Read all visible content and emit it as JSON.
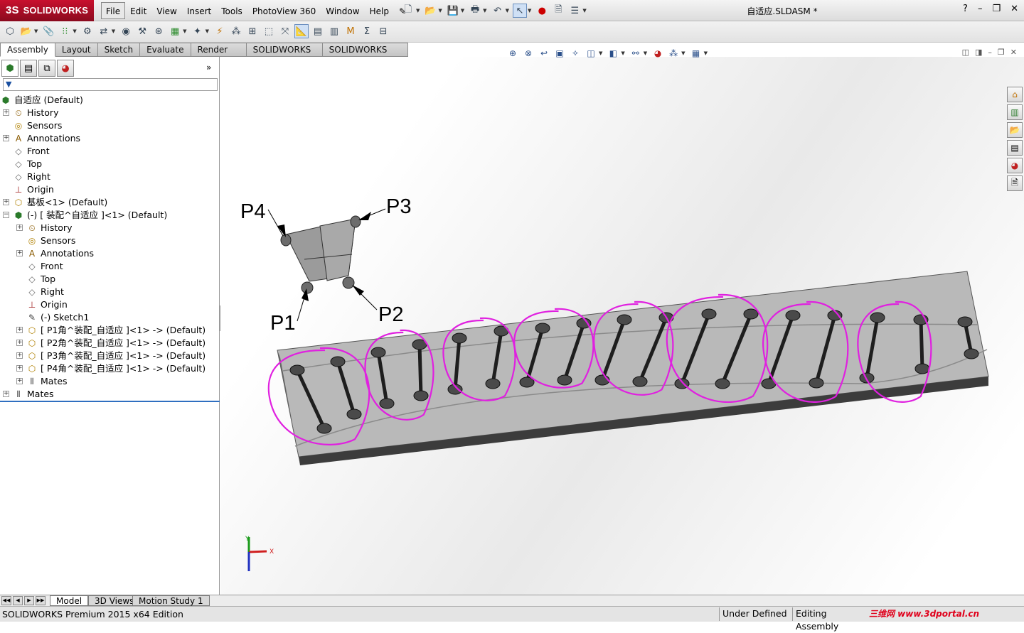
{
  "app": {
    "logo_prefix": "3S",
    "logo_text": "SOLIDWORKS",
    "doc_title": "自适应.SLDASM *"
  },
  "menu": [
    "File",
    "Edit",
    "View",
    "Insert",
    "Tools",
    "PhotoView 360",
    "Window",
    "Help"
  ],
  "window_controls": [
    "?",
    "–",
    "❐",
    "✕"
  ],
  "command_tabs": [
    "Assembly",
    "Layout",
    "Sketch",
    "Evaluate",
    "Render Tools",
    "SOLIDWORKS MBD",
    "SOLIDWORKS Add-Ins"
  ],
  "panel": {
    "expand_glyph": "»",
    "filter_glyph": "▼"
  },
  "tree": [
    {
      "label": "自适应  (Default)",
      "level": 0,
      "icon": "assembly-icon",
      "expander": ""
    },
    {
      "label": "History",
      "level": 0,
      "icon": "history-icon",
      "expander": "+"
    },
    {
      "label": "Sensors",
      "level": 0,
      "icon": "sensor-icon",
      "expander": ""
    },
    {
      "label": "Annotations",
      "level": 0,
      "icon": "annotation-icon",
      "expander": "+"
    },
    {
      "label": "Front",
      "level": 0,
      "icon": "plane-icon",
      "expander": ""
    },
    {
      "label": "Top",
      "level": 0,
      "icon": "plane-icon",
      "expander": ""
    },
    {
      "label": "Right",
      "level": 0,
      "icon": "plane-icon",
      "expander": ""
    },
    {
      "label": "Origin",
      "level": 0,
      "icon": "origin-icon",
      "expander": ""
    },
    {
      "label": "基板<1> (Default)",
      "level": 0,
      "icon": "part-icon",
      "expander": "+"
    },
    {
      "label": "(-) [ 装配^自适应 ]<1> (Default)",
      "level": 0,
      "icon": "subassembly-icon",
      "expander": "−"
    },
    {
      "label": "History",
      "level": 1,
      "icon": "history-icon",
      "expander": "+"
    },
    {
      "label": "Sensors",
      "level": 1,
      "icon": "sensor-icon",
      "expander": ""
    },
    {
      "label": "Annotations",
      "level": 1,
      "icon": "annotation-icon",
      "expander": "+"
    },
    {
      "label": "Front",
      "level": 1,
      "icon": "plane-icon",
      "expander": ""
    },
    {
      "label": "Top",
      "level": 1,
      "icon": "plane-icon",
      "expander": ""
    },
    {
      "label": "Right",
      "level": 1,
      "icon": "plane-icon",
      "expander": ""
    },
    {
      "label": "Origin",
      "level": 1,
      "icon": "origin-icon",
      "expander": ""
    },
    {
      "label": "(-) Sketch1",
      "level": 1,
      "icon": "sketch-icon",
      "expander": ""
    },
    {
      "label": "[ P1角^装配_自适应 ]<1> -> (Default)",
      "level": 1,
      "icon": "part-icon",
      "expander": "+"
    },
    {
      "label": "[ P2角^装配_自适应 ]<1> -> (Default)",
      "level": 1,
      "icon": "part-icon",
      "expander": "+"
    },
    {
      "label": "[ P3角^装配_自适应 ]<1> -> (Default)",
      "level": 1,
      "icon": "part-icon",
      "expander": "+"
    },
    {
      "label": "[ P4角^装配_自适应 ]<1> -> (Default)",
      "level": 1,
      "icon": "part-icon",
      "expander": "+"
    },
    {
      "label": "Mates",
      "level": 1,
      "icon": "mates-icon",
      "expander": "+"
    },
    {
      "label": "Mates",
      "level": 0,
      "icon": "mates-icon",
      "expander": "+"
    }
  ],
  "model_labels": {
    "p1": "P1",
    "p2": "P2",
    "p3": "P3",
    "p4": "P4"
  },
  "triad": {
    "x": "X",
    "y": "Y"
  },
  "bottom_tabs": [
    "Model",
    "3D Views",
    "Motion Study 1"
  ],
  "status": {
    "edition": "SOLIDWORKS Premium 2015 x64 Edition",
    "definition": "Under Defined",
    "mode": "Editing Assembly",
    "watermark": "三维网 www.3dportal.cn"
  },
  "colors": {
    "accent": "#c8102e",
    "highlight_loop": "#e020e0",
    "selection": "#2f6fc0",
    "plate": "#b8b8b8"
  }
}
